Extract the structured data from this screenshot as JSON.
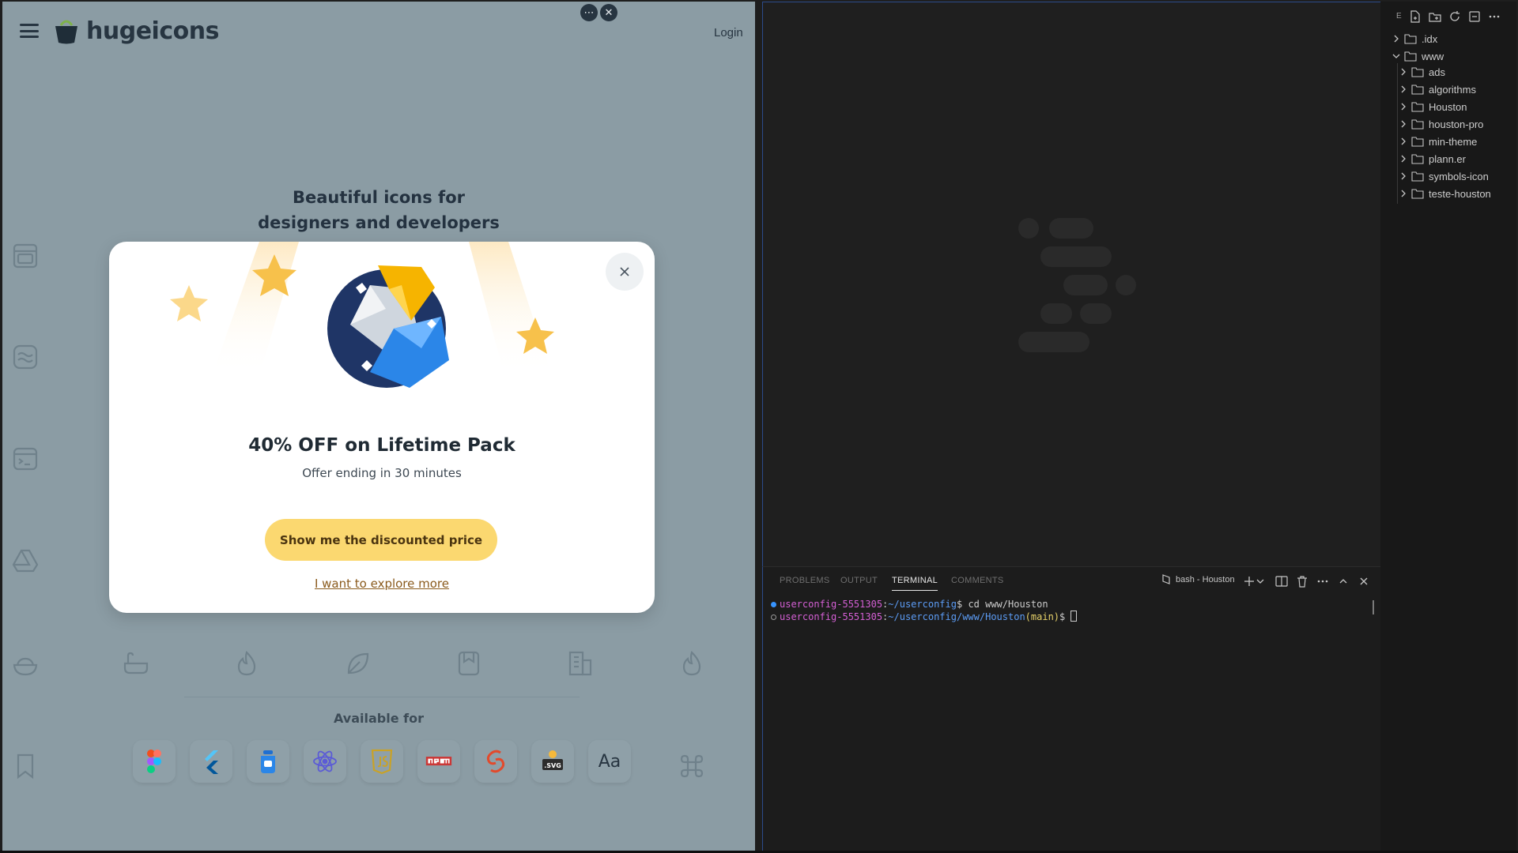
{
  "browser": {
    "brand": "hugeicons",
    "login_label": "Login",
    "more_label": "⋯",
    "close_label": "✕",
    "hero_line1": "Beautiful icons for",
    "hero_line2": "designers and developers",
    "available_label": "Available for",
    "font_tile_label": "Aa",
    "side_icons": [
      "oven-icon",
      "wave-icon",
      "code-window-icon",
      "drive-icon",
      "rice-bowl-icon",
      "bookmark-icon"
    ],
    "row_icons": [
      "bathtub-icon",
      "fire-icon",
      "leaf-icon",
      "bookmark-icon",
      "building-icon",
      "fire-icon"
    ],
    "frameworks": [
      "figma-icon",
      "flutter-icon",
      "jar-icon",
      "react-icon",
      "javascript-icon",
      "npm-icon",
      "svelte-icon",
      "svg-icon",
      "font-icon"
    ]
  },
  "modal": {
    "headline": "40% OFF on Lifetime Pack",
    "subline": "Offer ending in 30 minutes",
    "cta_label": "Show me the discounted price",
    "explore_label": "I want to explore more",
    "accent": "#fbd870"
  },
  "explorer": {
    "title": "E",
    "tree": [
      {
        "label": ".idx",
        "expanded": false
      },
      {
        "label": "www",
        "expanded": true
      },
      {
        "label": "ads",
        "expanded": false
      },
      {
        "label": "algorithms",
        "expanded": false
      },
      {
        "label": "Houston",
        "expanded": false
      },
      {
        "label": "houston-pro",
        "expanded": false
      },
      {
        "label": "min-theme",
        "expanded": false
      },
      {
        "label": "plann.er",
        "expanded": false
      },
      {
        "label": "symbols-icon",
        "expanded": false
      },
      {
        "label": "teste-houston",
        "expanded": false
      }
    ]
  },
  "panel": {
    "tabs": [
      "PROBLEMS",
      "OUTPUT",
      "TERMINAL",
      "COMMENTS"
    ],
    "active_tab": "TERMINAL",
    "terminal_name": "bash - Houston",
    "lines": [
      {
        "user": "userconfig-5551305",
        "sep": ":",
        "path": "~/userconfig",
        "branch": "",
        "prompt": "$ ",
        "command": "cd www/Houston"
      },
      {
        "user": "userconfig-5551305",
        "sep": ":",
        "path": "~/userconfig/www/Houston",
        "branch": "(main)",
        "prompt": "$ ",
        "command": ""
      }
    ]
  }
}
